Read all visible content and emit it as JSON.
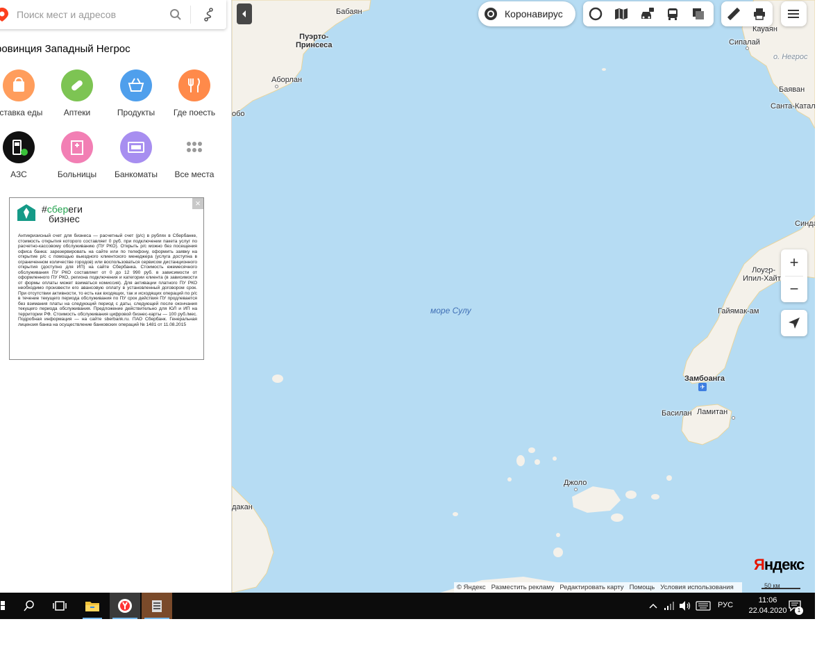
{
  "search": {
    "placeholder": "Поиск мест и адресов"
  },
  "region_title": "ровинция Западный Негрос",
  "categories": [
    {
      "label": "оставка еды",
      "icon": "food-delivery-bag-icon",
      "color": "#ff9d5c"
    },
    {
      "label": "Аптеки",
      "icon": "pharmacy-pill-icon",
      "color": "#7dc453"
    },
    {
      "label": "Продукты",
      "icon": "grocery-basket-icon",
      "color": "#4f9fec"
    },
    {
      "label": "Где поесть",
      "icon": "fork-knife-icon",
      "color": "#ff8a4a"
    },
    {
      "label": "АЗС",
      "icon": "gas-station-icon",
      "color": "#111111"
    },
    {
      "label": "Больницы",
      "icon": "hospital-icon",
      "color": "#f27fb4"
    },
    {
      "label": "Банкоматы",
      "icon": "atm-icon",
      "color": "#a78ef0"
    },
    {
      "label": "Все места",
      "icon": "grid-dots-icon",
      "color": "#9a9a9a"
    }
  ],
  "ad": {
    "brand_prefix": "#",
    "brand_green": "сбер",
    "brand_suffix": "еги",
    "brand_line2": "бизнес",
    "close": "×",
    "legal_text": "Антикризисный счет для бизнеса — расчетный счет (р/с) в рублях в Сбербанке, стоимость открытия которого составляет 0 руб. при подключении пакета услуг по расчетно-кассовому обслуживанию (ПУ РКО). Открыть р/с можно без посещения офиса банка: зарезервировать на сайте или по телефону, оформить заявку на открытие р/с с помощью выездного клиентского менеджера (услуга доступна в ограниченном количестве городов) или воспользоваться сервисом дистанционного открытия (доступно для ИП) на сайте Сбербанка. Стоимость ежемесячного обслуживания ПУ РКО составляет от 0 до 12 990 руб. в зависимости от оформленного ПУ РКО, региона подключения и категории клиента (в зависимости от формы оплаты может взиматься комиссия). Для активации платного ПУ РКО необходимо произвести его авансовую оплату в установленный договором срок. При отсутствии активности, то есть как входящих, так и исходящих операций по р/с в течение текущего периода обслуживания по ПУ срок действия ПУ продлевается без взимания платы на следующий период с даты, следующей после окончания текущего периода обслуживания. Предложение действительно для ЮЛ и ИП на территории РФ. Стоимость обслуживания цифровой бизнес-карты — 100 руб./мес. Подробная информация — на сайте sberbank.ru. ПАО Сбербанк. Генеральная лицензия банка на осуществление банковских операций № 1481 от 11.08.2015"
  },
  "map": {
    "coronavirus_label": "Коронавирус",
    "sea_label": "море Сулу",
    "labels": {
      "babayan": "Бабаян",
      "puerto": "Пуэрто-\nПринсеса",
      "aborlan": "Аборлан",
      "bobo": "обо",
      "kauayan": "Кауаян",
      "ka": "Ка",
      "sipalay": "Сипалай",
      "negros": "о. Негрос",
      "bayavan": "Баяван",
      "santa": "Санта-Катал",
      "sinda": "Синда",
      "lower": "Лоуэр-\nИпил-Хайтс",
      "gayamak": "Гайямак-ам",
      "zamboanga": "Замбоанга",
      "basilan": "Басилан",
      "lamitan": "Ламитан",
      "jolo": "Джоло",
      "dakan": "дакан"
    },
    "zoom_in": "+",
    "zoom_out": "−",
    "logo_first": "Я",
    "logo_rest": "ндекс",
    "scale": "50 км",
    "copyright_items": [
      "© Яндекс",
      "Разместить рекламу",
      "Редактировать карту",
      "Помощь",
      "Условия использования"
    ]
  },
  "taskbar": {
    "language": "РУС",
    "time": "11:06",
    "date": "22.04.2020",
    "notification_count": "1"
  }
}
